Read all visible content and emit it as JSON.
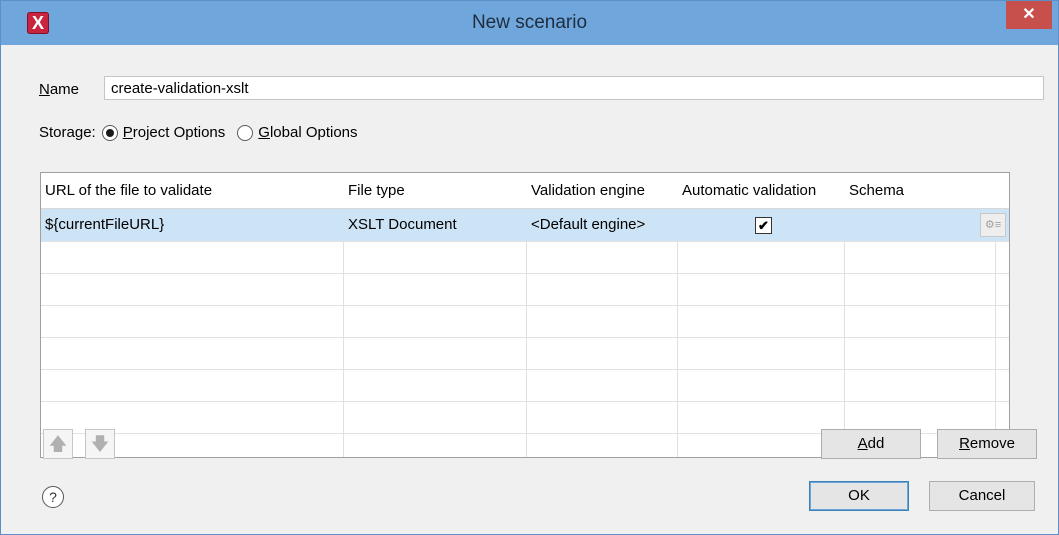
{
  "window": {
    "title": "New scenario",
    "app_icon_glyph": "X",
    "close_glyph": "✕",
    "accent_color": "#6fa7dd"
  },
  "name_field": {
    "label_mnemonic": "N",
    "label_rest": "ame",
    "value": "create-validation-xslt"
  },
  "storage": {
    "label": "Storage:",
    "options": [
      {
        "mnemonic": "P",
        "rest": "roject Options",
        "checked": true
      },
      {
        "mnemonic": "G",
        "rest": "lobal Options",
        "checked": false
      }
    ]
  },
  "table": {
    "columns": [
      "URL of the file to validate",
      "File type",
      "Validation engine",
      "Automatic validation",
      "Schema"
    ],
    "rows": [
      {
        "url": "${currentFileURL}",
        "file_type": "XSLT Document",
        "engine": "<Default engine>",
        "automatic": true,
        "schema": ""
      }
    ],
    "check_glyph": "✔",
    "gear_icon": "gear-icon",
    "gear_glyph": "⚙≡",
    "selected_row_color": "#cde4f7"
  },
  "buttons": {
    "move_up_glyph": "🡅",
    "move_down_glyph": "🡇",
    "add_mnemonic": "A",
    "add_rest": "dd",
    "remove_mnemonic": "R",
    "remove_rest": "emove",
    "ok": "OK",
    "cancel": "Cancel",
    "help_glyph": "?"
  }
}
